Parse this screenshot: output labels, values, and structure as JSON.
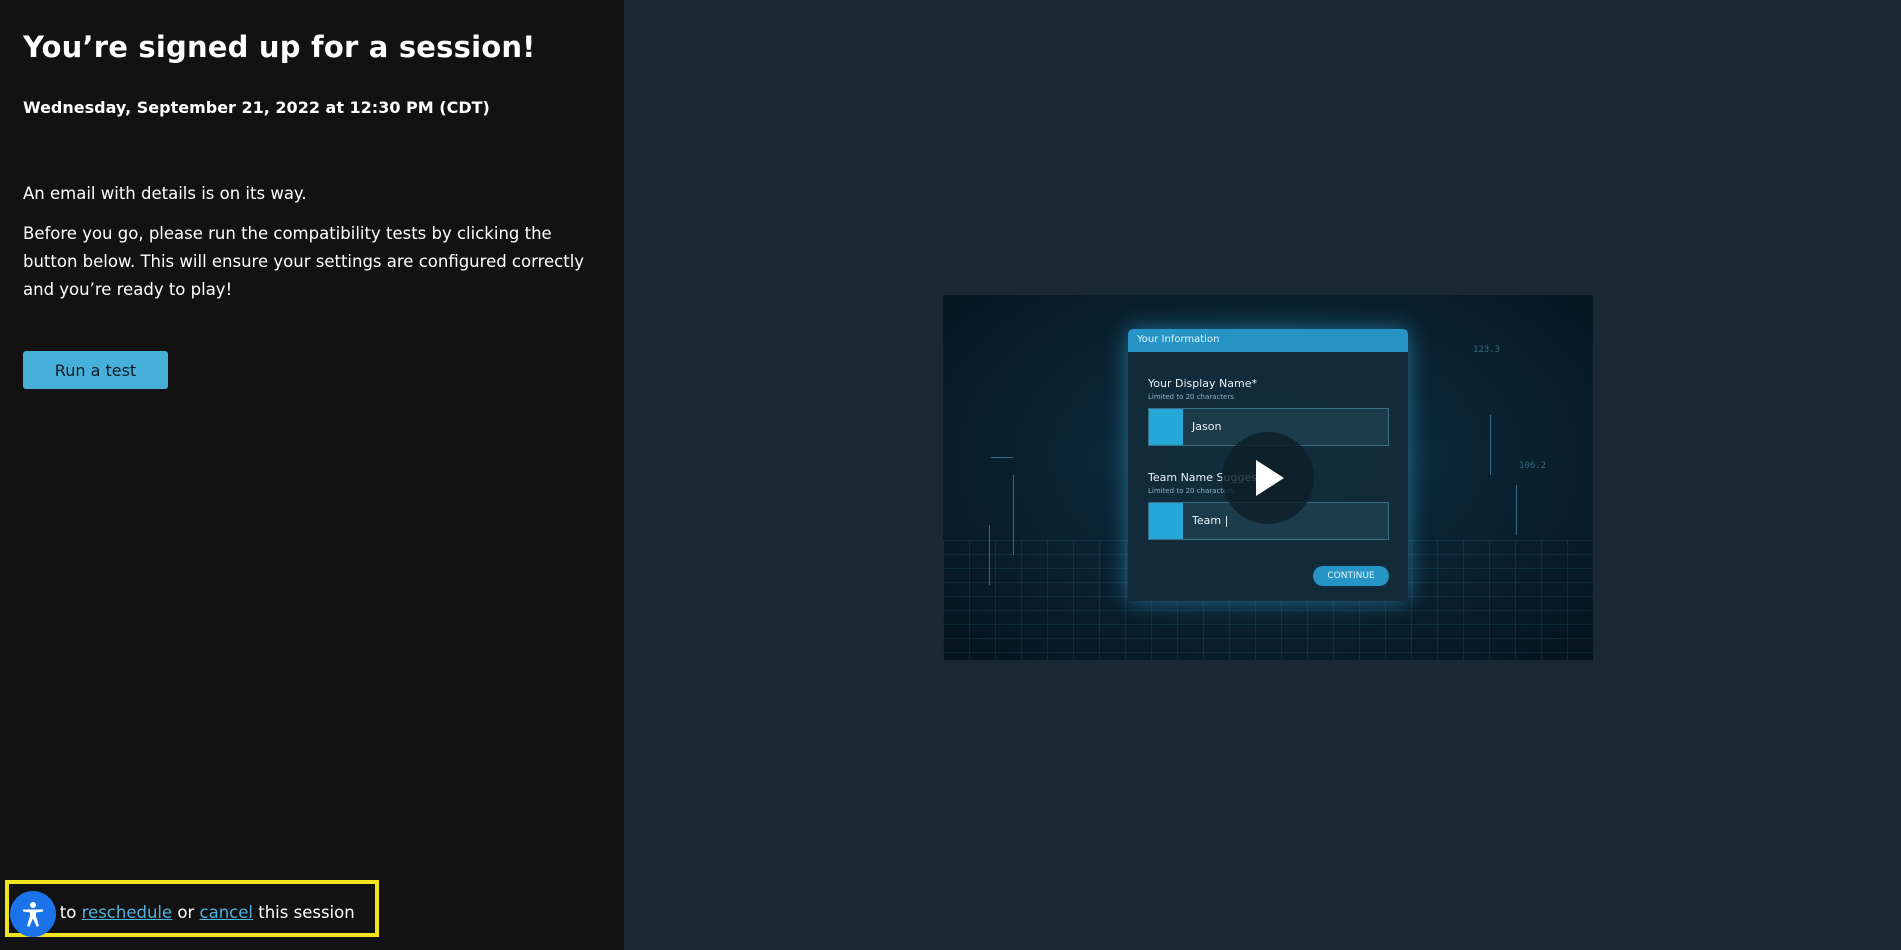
{
  "session": {
    "title": "You’re signed up for a session!",
    "date": "Wednesday, September 21, 2022 at 12:30 PM (CDT)",
    "email_note": "An email with details is on its way.",
    "instructions": "Before you go, please run the compatibility tests by clicking the button below. This will ensure your settings are configured correctly and you’re ready to play!",
    "run_test_label": "Run a test"
  },
  "manage": {
    "prefix": "k to",
    "reschedule_label": "reschedule",
    "middle": "or",
    "cancel_label": "cancel",
    "suffix": "this session"
  },
  "video": {
    "form_header": "Your Information",
    "display_name_label": "Your Display Name*",
    "display_name_hint": "Limited to 20 characters",
    "display_name_value": "Jason",
    "team_name_label": "Team Name Suggest",
    "team_name_hint": "Limited to 20 characters",
    "team_name_value": "Team |",
    "continue_label": "CONTINUE",
    "deco_num_1": "123.3",
    "deco_num_2": "106.2"
  },
  "icons": {
    "accessibility": "accessibility-icon",
    "play": "play-icon"
  },
  "colors": {
    "left_panel": "#121212",
    "right_panel": "#1a2833",
    "accent": "#46b0da",
    "link": "#4fb3e0",
    "highlight_border": "#f2e41c",
    "accessibility": "#1a73e8"
  }
}
